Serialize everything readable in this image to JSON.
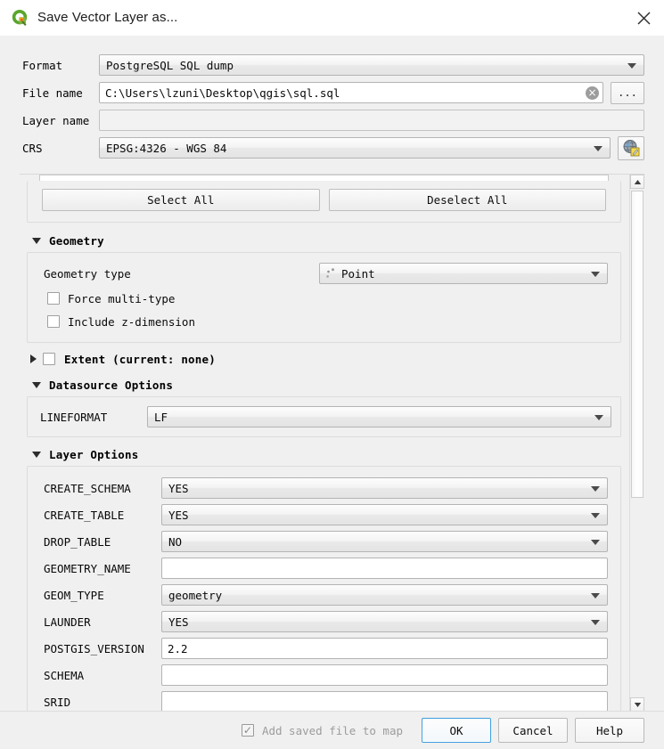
{
  "window": {
    "title": "Save Vector Layer as...",
    "app_icon": "qgis-logo-icon",
    "close_icon": "close-icon"
  },
  "form": {
    "format": {
      "label": "Format",
      "value": "PostgreSQL SQL dump"
    },
    "file_name": {
      "label": "File name",
      "value": "C:\\Users\\lzuni\\Desktop\\qgis\\sql.sql",
      "clear_icon": "clear-icon",
      "browse_label": "..."
    },
    "layer_name": {
      "label": "Layer name",
      "value": "",
      "placeholder": ""
    },
    "crs": {
      "label": "CRS",
      "value": "EPSG:4326 - WGS 84",
      "select_icon": "globe-edit-icon"
    }
  },
  "fields_section": {
    "select_all_label": "Select All",
    "deselect_all_label": "Deselect All"
  },
  "geometry_section": {
    "title": "Geometry",
    "geometry_type": {
      "label": "Geometry type",
      "value": "Point",
      "icon": "point-geometry-icon"
    },
    "force_multi_type": {
      "label": "Force multi-type",
      "checked": false
    },
    "include_z": {
      "label": "Include z-dimension",
      "checked": false
    }
  },
  "extent_section": {
    "title": "Extent (current: none)",
    "checked": false,
    "expanded": false
  },
  "datasource_section": {
    "title": "Datasource Options",
    "options": [
      {
        "name": "LINEFORMAT",
        "value": "LF",
        "type": "combo"
      }
    ]
  },
  "layer_options_section": {
    "title": "Layer Options",
    "options": [
      {
        "name": "CREATE_SCHEMA",
        "value": "YES",
        "type": "combo"
      },
      {
        "name": "CREATE_TABLE",
        "value": "YES",
        "type": "combo"
      },
      {
        "name": "DROP_TABLE",
        "value": "NO",
        "type": "combo"
      },
      {
        "name": "GEOMETRY_NAME",
        "value": "",
        "type": "text"
      },
      {
        "name": "GEOM_TYPE",
        "value": "geometry",
        "type": "combo"
      },
      {
        "name": "LAUNDER",
        "value": "YES",
        "type": "combo"
      },
      {
        "name": "POSTGIS_VERSION",
        "value": "2.2",
        "type": "text"
      },
      {
        "name": "SCHEMA",
        "value": "",
        "type": "text"
      },
      {
        "name": "SRID",
        "value": "",
        "type": "text"
      }
    ]
  },
  "footer": {
    "add_saved_file_to_map": {
      "label": "Add saved file to map",
      "checked": true,
      "enabled": false
    },
    "ok_label": "OK",
    "cancel_label": "Cancel",
    "help_label": "Help"
  },
  "scrollbar": {
    "up_icon": "scroll-up-icon",
    "down_icon": "scroll-down-icon"
  },
  "colors": {
    "accent": "#3f9ede",
    "dialog_bg": "#f0f0f0",
    "titlebar_bg": "#ffffff",
    "logo_green": "#5aa52b",
    "logo_accent": "#f5a623"
  }
}
